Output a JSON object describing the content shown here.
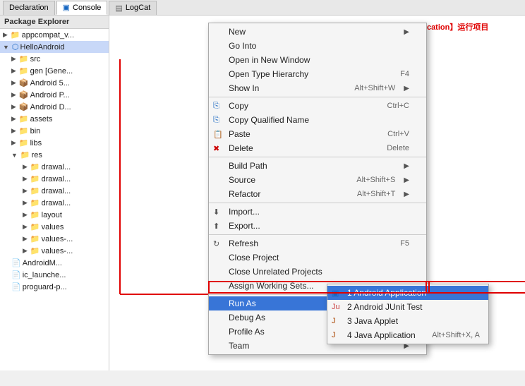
{
  "tabBar": {
    "tabs": [
      {
        "id": "declaration",
        "label": "Declaration",
        "active": false
      },
      {
        "id": "console",
        "label": "Console",
        "active": true,
        "icon": "▣"
      },
      {
        "id": "logcat",
        "label": "LogCat",
        "active": false,
        "icon": "▤"
      }
    ]
  },
  "packageExplorer": {
    "title": "Package Explorer",
    "items": [
      {
        "label": "appcompat_v...",
        "level": 1,
        "type": "folder",
        "arrow": "▶"
      },
      {
        "label": "HelloAndroid",
        "level": 1,
        "type": "project",
        "arrow": "▼",
        "selected": true
      },
      {
        "label": "src",
        "level": 2,
        "type": "folder",
        "arrow": "▶"
      },
      {
        "label": "gen [Gene...",
        "level": 2,
        "type": "folder",
        "arrow": "▶"
      },
      {
        "label": "Android 5...",
        "level": 2,
        "type": "lib",
        "arrow": "▶"
      },
      {
        "label": "Android P...",
        "level": 2,
        "type": "lib",
        "arrow": "▶"
      },
      {
        "label": "Android D...",
        "level": 2,
        "type": "lib",
        "arrow": "▶"
      },
      {
        "label": "assets",
        "level": 2,
        "type": "folder",
        "arrow": "▶"
      },
      {
        "label": "bin",
        "level": 2,
        "type": "folder",
        "arrow": "▶"
      },
      {
        "label": "libs",
        "level": 2,
        "type": "folder",
        "arrow": "▶"
      },
      {
        "label": "res",
        "level": 2,
        "type": "folder",
        "arrow": "▼"
      },
      {
        "label": "drawal...",
        "level": 3,
        "type": "folder",
        "arrow": "▶"
      },
      {
        "label": "drawal...",
        "level": 3,
        "type": "folder",
        "arrow": "▶"
      },
      {
        "label": "drawal...",
        "level": 3,
        "type": "folder",
        "arrow": "▶"
      },
      {
        "label": "drawal...",
        "level": 3,
        "type": "folder",
        "arrow": "▶"
      },
      {
        "label": "layout",
        "level": 3,
        "type": "folder",
        "arrow": "▶"
      },
      {
        "label": "values",
        "level": 3,
        "type": "folder",
        "arrow": "▶"
      },
      {
        "label": "values-...",
        "level": 3,
        "type": "folder",
        "arrow": "▶"
      },
      {
        "label": "values-...",
        "level": 3,
        "type": "folder",
        "arrow": "▶"
      },
      {
        "label": "AndroidM...",
        "level": 2,
        "type": "file"
      },
      {
        "label": "ic_launche...",
        "level": 2,
        "type": "file"
      },
      {
        "label": "proguard-p...",
        "level": 2,
        "type": "file"
      }
    ]
  },
  "contextMenu": {
    "items": [
      {
        "id": "new",
        "label": "New",
        "hasArrow": true
      },
      {
        "id": "go-into",
        "label": "Go Into",
        "hasArrow": false
      },
      {
        "id": "open-new-window",
        "label": "Open in New Window",
        "hasArrow": false
      },
      {
        "id": "open-type-hierarchy",
        "label": "Open Type Hierarchy",
        "shortcut": "F4",
        "hasArrow": false
      },
      {
        "id": "show-in",
        "label": "Show In",
        "shortcut": "Alt+Shift+W",
        "hasArrow": true
      },
      {
        "id": "sep1",
        "type": "separator"
      },
      {
        "id": "copy",
        "label": "Copy",
        "shortcut": "Ctrl+C",
        "icon": "copy"
      },
      {
        "id": "copy-qualified-name",
        "label": "Copy Qualified Name"
      },
      {
        "id": "paste",
        "label": "Paste",
        "shortcut": "Ctrl+V",
        "icon": "paste"
      },
      {
        "id": "delete",
        "label": "Delete",
        "shortcut": "Delete",
        "icon": "delete"
      },
      {
        "id": "sep2",
        "type": "separator"
      },
      {
        "id": "build-path",
        "label": "Build Path",
        "hasArrow": true
      },
      {
        "id": "source",
        "label": "Source",
        "shortcut": "Alt+Shift+S",
        "hasArrow": true
      },
      {
        "id": "refactor",
        "label": "Refactor",
        "shortcut": "Alt+Shift+T",
        "hasArrow": true
      },
      {
        "id": "sep3",
        "type": "separator"
      },
      {
        "id": "import",
        "label": "Import...",
        "icon": "import"
      },
      {
        "id": "export",
        "label": "Export...",
        "icon": "export"
      },
      {
        "id": "sep4",
        "type": "separator"
      },
      {
        "id": "refresh",
        "label": "Refresh",
        "shortcut": "F5",
        "icon": "refresh"
      },
      {
        "id": "close-project",
        "label": "Close Project"
      },
      {
        "id": "close-unrelated",
        "label": "Close Unrelated Projects"
      },
      {
        "id": "assign-working-sets",
        "label": "Assign Working Sets..."
      },
      {
        "id": "sep5",
        "type": "separator"
      },
      {
        "id": "run-as",
        "label": "Run As",
        "hasArrow": true,
        "highlighted": true
      },
      {
        "id": "debug-as",
        "label": "Debug As",
        "hasArrow": true
      },
      {
        "id": "profile-as",
        "label": "Profile As",
        "hasArrow": true
      },
      {
        "id": "team",
        "label": "Team",
        "hasArrow": true
      }
    ]
  },
  "runAsSubmenu": {
    "items": [
      {
        "id": "android-app",
        "label": "1 Android Application",
        "highlighted": true,
        "icon": "▣"
      },
      {
        "id": "junit-test",
        "label": "2 Android JUnit Test",
        "icon": "Ju"
      },
      {
        "id": "java-applet",
        "label": "3 Java Applet",
        "icon": "J"
      },
      {
        "id": "java-app",
        "label": "4 Java Application",
        "shortcut": "Alt+Shift+X, A",
        "icon": "J"
      }
    ]
  },
  "annotation": {
    "text": "选中项目---->右键---->【Run As】------>【Android Application】运行项目",
    "color": "#e00000"
  },
  "colors": {
    "highlight_blue": "#3875d7",
    "red": "#e00000",
    "menu_bg": "#f5f5f5"
  }
}
